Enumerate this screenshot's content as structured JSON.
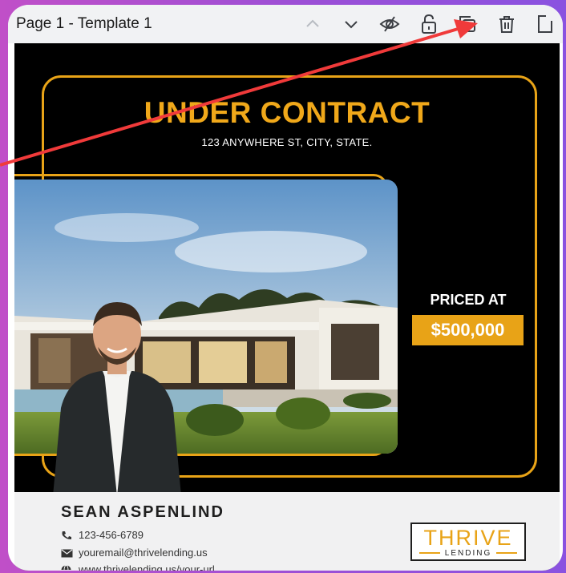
{
  "toolbar": {
    "page_title": "Page 1 - Template 1",
    "icons": [
      "chevron-up-icon",
      "chevron-down-icon",
      "hide-icon",
      "lock-icon",
      "duplicate-icon",
      "trash-icon",
      "add-page-icon"
    ]
  },
  "flyer": {
    "headline": "UNDER CONTRACT",
    "address": "123 ANYWHERE ST, CITY, STATE.",
    "priced_label": "PRICED AT",
    "price": "$500,000"
  },
  "agent": {
    "name": "SEAN ASPENLIND",
    "phone": "123-456-6789",
    "email": "youremail@thrivelending.us",
    "website": "www.thrivelending.us/your-url"
  },
  "logo": {
    "word": "THRIVE",
    "sub": "LENDING"
  },
  "colors": {
    "accent": "#e8a317",
    "arrow": "#f03a3a",
    "canvas": "#000000"
  }
}
